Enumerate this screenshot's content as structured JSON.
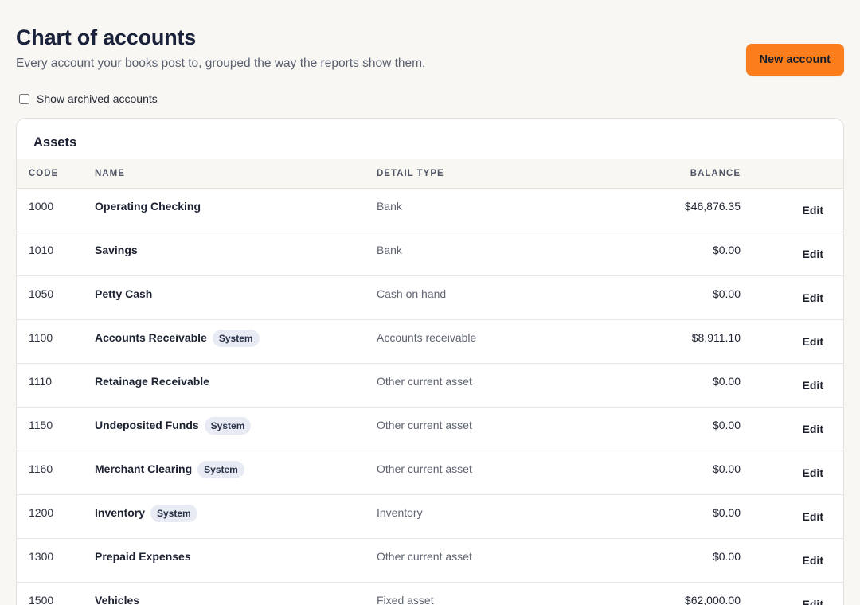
{
  "header": {
    "title": "Chart of accounts",
    "subtitle": "Every account your books post to, grouped the way the reports show them.",
    "new_account_label": "New account"
  },
  "filters": {
    "show_archived_label": "Show archived accounts",
    "show_archived_checked": false
  },
  "group": {
    "title": "Assets",
    "columns": {
      "code": "CODE",
      "name": "NAME",
      "detail_type": "DETAIL TYPE",
      "balance": "BALANCE"
    },
    "edit_label": "Edit",
    "system_label": "System",
    "rows": [
      {
        "code": "1000",
        "name": "Operating Checking",
        "system": false,
        "detail_type": "Bank",
        "balance": "$46,876.35"
      },
      {
        "code": "1010",
        "name": "Savings",
        "system": false,
        "detail_type": "Bank",
        "balance": "$0.00"
      },
      {
        "code": "1050",
        "name": "Petty Cash",
        "system": false,
        "detail_type": "Cash on hand",
        "balance": "$0.00"
      },
      {
        "code": "1100",
        "name": "Accounts Receivable",
        "system": true,
        "detail_type": "Accounts receivable",
        "balance": "$8,911.10"
      },
      {
        "code": "1110",
        "name": "Retainage Receivable",
        "system": false,
        "detail_type": "Other current asset",
        "balance": "$0.00"
      },
      {
        "code": "1150",
        "name": "Undeposited Funds",
        "system": true,
        "detail_type": "Other current asset",
        "balance": "$0.00"
      },
      {
        "code": "1160",
        "name": "Merchant Clearing",
        "system": true,
        "detail_type": "Other current asset",
        "balance": "$0.00"
      },
      {
        "code": "1200",
        "name": "Inventory",
        "system": true,
        "detail_type": "Inventory",
        "balance": "$0.00"
      },
      {
        "code": "1300",
        "name": "Prepaid Expenses",
        "system": false,
        "detail_type": "Other current asset",
        "balance": "$0.00"
      },
      {
        "code": "1500",
        "name": "Vehicles",
        "system": false,
        "detail_type": "Fixed asset",
        "balance": "$62,000.00"
      }
    ]
  },
  "colors": {
    "accent": "#fb7d1c",
    "page_background": "#f8f7f3",
    "badge_background": "#e8ebf3"
  }
}
